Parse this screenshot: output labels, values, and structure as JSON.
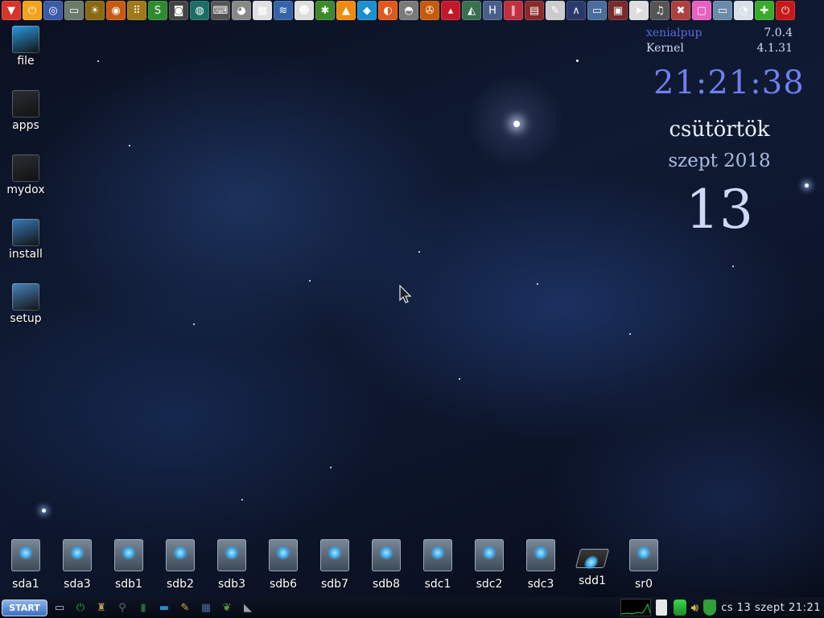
{
  "top_launcher": [
    {
      "name": "shutdown-arrow-icon",
      "glyph": "▼",
      "color": "#d8342a"
    },
    {
      "name": "power-orange-icon",
      "glyph": "⏻",
      "color": "#f2a31a"
    },
    {
      "name": "network-wizard-icon",
      "glyph": "◎",
      "color": "#3b5aa8"
    },
    {
      "name": "drive-icon",
      "glyph": "▭",
      "color": "#6c7b6a"
    },
    {
      "name": "sun-settings-icon",
      "glyph": "☀",
      "color": "#8a6a10"
    },
    {
      "name": "cd-burner-icon",
      "glyph": "◉",
      "color": "#c55a12"
    },
    {
      "name": "dots-grid-icon",
      "glyph": "⠿",
      "color": "#a07818"
    },
    {
      "name": "s-app-icon",
      "glyph": "S",
      "color": "#2e8b2e"
    },
    {
      "name": "camera-icon",
      "glyph": "◙",
      "color": "#444444"
    },
    {
      "name": "globe-icon",
      "glyph": "◍",
      "color": "#1b6e63"
    },
    {
      "name": "scanner-icon",
      "glyph": "⌨",
      "color": "#555555"
    },
    {
      "name": "webcam-icon",
      "glyph": "◕",
      "color": "#888888"
    },
    {
      "name": "image-viewer-icon",
      "glyph": "▦",
      "color": "#e0e0e0"
    },
    {
      "name": "wifi-icon",
      "glyph": "≋",
      "color": "#3463a8"
    },
    {
      "name": "panda-icon",
      "glyph": "☻",
      "color": "#dddddd"
    },
    {
      "name": "frog-icon",
      "glyph": "✱",
      "color": "#3c8a2c"
    },
    {
      "name": "vlc-icon",
      "glyph": "▲",
      "color": "#f08a10"
    },
    {
      "name": "kodi-icon",
      "glyph": "◆",
      "color": "#1b8fd0"
    },
    {
      "name": "firefox-icon",
      "glyph": "◐",
      "color": "#e0581c"
    },
    {
      "name": "browser-pro-icon",
      "glyph": "◓",
      "color": "#7a7a7a"
    },
    {
      "name": "puppy-tools-icon",
      "glyph": "✇",
      "color": "#c65a0a"
    },
    {
      "name": "hat-icon",
      "glyph": "▴",
      "color": "#c4182a"
    },
    {
      "name": "monitor-graph-icon",
      "glyph": "◭",
      "color": "#3c6e50"
    },
    {
      "name": "h2-icon",
      "glyph": "H",
      "color": "#4a5e8a"
    },
    {
      "name": "pencils-icon",
      "glyph": "∥",
      "color": "#c03040"
    },
    {
      "name": "book-icon",
      "glyph": "▤",
      "color": "#8a2a2a"
    },
    {
      "name": "notepad-icon",
      "glyph": "✎",
      "color": "#cccccc"
    },
    {
      "name": "lambda-icon",
      "glyph": "∧",
      "color": "#2a3a6a"
    },
    {
      "name": "display-icon",
      "glyph": "▭",
      "color": "#4a6e9a"
    },
    {
      "name": "screen-record-icon",
      "glyph": "▣",
      "color": "#7a2a2a"
    },
    {
      "name": "pointer-icon",
      "glyph": "➤",
      "color": "#dddddd"
    },
    {
      "name": "mixer-icon",
      "glyph": "♫",
      "color": "#555555"
    },
    {
      "name": "tools-icon",
      "glyph": "✖",
      "color": "#b04040"
    },
    {
      "name": "pink-window-icon",
      "glyph": "▢",
      "color": "#e860c0"
    },
    {
      "name": "printer-icon",
      "glyph": "▭",
      "color": "#6a8aaa"
    },
    {
      "name": "clock-icon",
      "glyph": "◔",
      "color": "#d8e0ea"
    },
    {
      "name": "green-puzzle-icon",
      "glyph": "✚",
      "color": "#3aaa28"
    },
    {
      "name": "power-red-icon",
      "glyph": "⏻",
      "color": "#c81818"
    }
  ],
  "desktop_icons": [
    {
      "label": "file",
      "name": "file-icon",
      "color": "#2a9ae0"
    },
    {
      "label": "apps",
      "name": "apps-icon",
      "color": "#2a2f36"
    },
    {
      "label": "mydox",
      "name": "mydox-icon",
      "color": "#2a2f36"
    },
    {
      "label": "install",
      "name": "install-icon",
      "color": "#3a7ab8"
    },
    {
      "label": "setup",
      "name": "setup-icon",
      "color": "#4a86c0"
    }
  ],
  "sysinfo": {
    "distro": "xenialpup",
    "distro_version": "7.0.4",
    "kernel_label": "Kernel",
    "kernel_version": "4.1.31",
    "distro_color": "#5a6ae8",
    "text_color": "#d0dcf5"
  },
  "clock_widget": {
    "time": "21:21:38",
    "weekday": "csütörtök",
    "month_year": "szept 2018",
    "day": "13"
  },
  "drives": [
    "sda1",
    "sda3",
    "sdb1",
    "sdb2",
    "sdb3",
    "sdb6",
    "sdb7",
    "sdb8",
    "sdc1",
    "sdc2",
    "sdc3",
    "sdd1",
    "sr0"
  ],
  "taskbar": {
    "start_label": "START",
    "quicklaunch": [
      {
        "name": "show-desktop-icon",
        "glyph": "▭",
        "color": "#c0c8d0"
      },
      {
        "name": "power-icon",
        "glyph": "⏻",
        "color": "#2faa3a"
      },
      {
        "name": "tools-hat-icon",
        "glyph": "♜",
        "color": "#b8a060"
      },
      {
        "name": "magnifier-icon",
        "glyph": "⚲",
        "color": "#6a6a6a"
      },
      {
        "name": "terminal-icon",
        "glyph": "▮",
        "color": "#2a6a3a"
      },
      {
        "name": "monitor-icon",
        "glyph": "▬",
        "color": "#2a8ac8"
      },
      {
        "name": "file-manager-icon",
        "glyph": "✎",
        "color": "#d8b040"
      },
      {
        "name": "calculator-icon",
        "glyph": "▦",
        "color": "#4a6a9a"
      },
      {
        "name": "leaf-icon",
        "glyph": "❦",
        "color": "#5aa03a"
      },
      {
        "name": "eraser-icon",
        "glyph": "◣",
        "color": "#9aa0a8"
      }
    ],
    "tray_clock": "cs 13 szept 21:21"
  }
}
